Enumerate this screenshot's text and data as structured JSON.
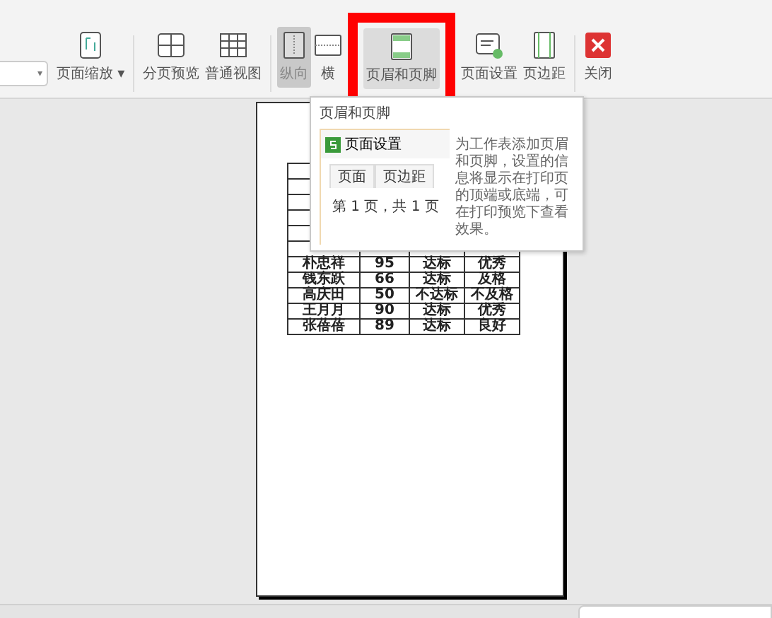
{
  "toolbar": {
    "zoom_field": {
      "caret": "▾"
    },
    "items": [
      {
        "label": "页面缩放",
        "kind": "zoom",
        "caret": "▾",
        "selected": false,
        "highlighted": false
      },
      {
        "label": "分页预览",
        "kind": "split",
        "selected": false,
        "highlighted": false,
        "separator_before": true
      },
      {
        "label": "普通视图",
        "kind": "grid",
        "selected": false,
        "highlighted": false
      },
      {
        "label": "纵向",
        "kind": "portrait",
        "selected": true,
        "highlighted": false,
        "separator_before": true
      },
      {
        "label": "横",
        "kind": "landscape",
        "selected": false,
        "highlighted": false
      },
      {
        "label": "页眉和页脚",
        "kind": "header",
        "selected": false,
        "highlighted": true
      },
      {
        "label": "页面设置",
        "kind": "setup",
        "selected": false,
        "highlighted": false
      },
      {
        "label": "页边距",
        "kind": "margins",
        "selected": false,
        "highlighted": false
      },
      {
        "label": "关闭",
        "kind": "close",
        "selected": false,
        "highlighted": false,
        "separator_before": true
      }
    ]
  },
  "sheet": {
    "rows": [
      {
        "cells": [
          "朴忠祥",
          "95",
          "达标",
          "优秀"
        ]
      },
      {
        "cells": [
          "钱东跃",
          "66",
          "达标",
          "及格"
        ]
      },
      {
        "cells": [
          "高庆田",
          "50",
          "不达标",
          "不及格"
        ]
      },
      {
        "cells": [
          "王月月",
          "90",
          "达标",
          "优秀"
        ]
      },
      {
        "cells": [
          "张蓓蓓",
          "89",
          "达标",
          "良好"
        ]
      }
    ]
  },
  "tooltip": {
    "title": "页眉和页脚",
    "preview": {
      "dialog_title": "页面设置",
      "tabs": [
        "页面",
        "页边距"
      ],
      "sample": "第 1 页，共 1 页"
    },
    "description": "为工作表添加页眉和页脚，设置的信息将显示在打印页的顶端或底端，可在打印预览下查看效果。"
  }
}
